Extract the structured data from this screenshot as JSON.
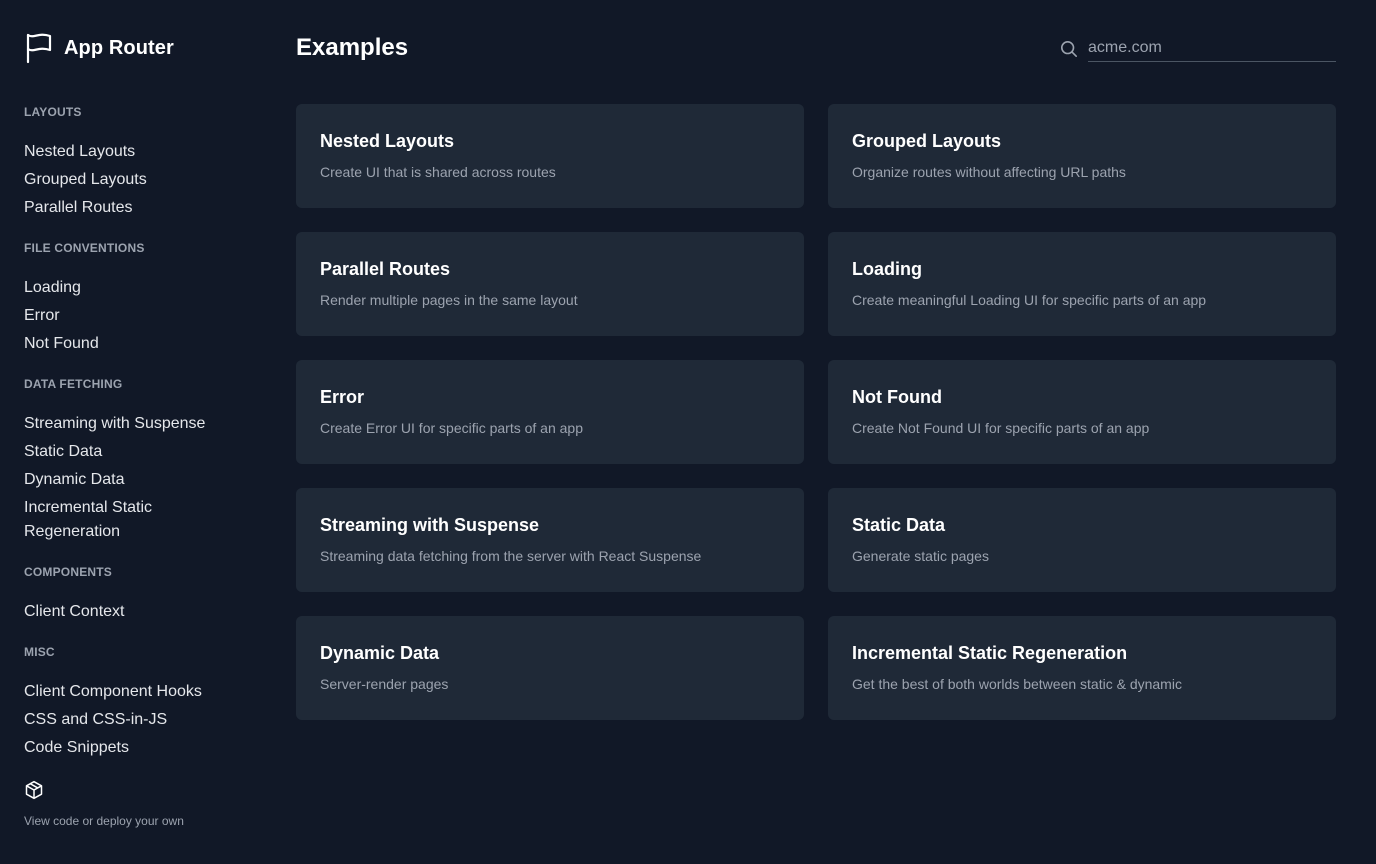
{
  "brand": {
    "title": "App Router"
  },
  "sidebar": {
    "groups": [
      {
        "label": "LAYOUTS",
        "items": [
          "Nested Layouts",
          "Grouped Layouts",
          "Parallel Routes"
        ]
      },
      {
        "label": "FILE CONVENTIONS",
        "items": [
          "Loading",
          "Error",
          "Not Found"
        ]
      },
      {
        "label": "DATA FETCHING",
        "items": [
          "Streaming with Suspense",
          "Static Data",
          "Dynamic Data",
          "Incremental Static Regeneration"
        ]
      },
      {
        "label": "COMPONENTS",
        "items": [
          "Client Context"
        ]
      },
      {
        "label": "MISC",
        "items": [
          "Client Component Hooks",
          "CSS and CSS-in-JS",
          "Code Snippets"
        ]
      }
    ],
    "footer_text": "View code or deploy your own",
    "footer_icon": "codesandbox-icon"
  },
  "main": {
    "title": "Examples",
    "search": {
      "placeholder": "acme.com",
      "value": "",
      "icon": "search-icon"
    },
    "cards": [
      {
        "title": "Nested Layouts",
        "description": "Create UI that is shared across routes"
      },
      {
        "title": "Grouped Layouts",
        "description": "Organize routes without affecting URL paths"
      },
      {
        "title": "Parallel Routes",
        "description": "Render multiple pages in the same layout"
      },
      {
        "title": "Loading",
        "description": "Create meaningful Loading UI for specific parts of an app"
      },
      {
        "title": "Error",
        "description": "Create Error UI for specific parts of an app"
      },
      {
        "title": "Not Found",
        "description": "Create Not Found UI for specific parts of an app"
      },
      {
        "title": "Streaming with Suspense",
        "description": "Streaming data fetching from the server with React Suspense"
      },
      {
        "title": "Static Data",
        "description": "Generate static pages"
      },
      {
        "title": "Dynamic Data",
        "description": "Server-render pages"
      },
      {
        "title": "Incremental Static Regeneration",
        "description": "Get the best of both worlds between static & dynamic"
      }
    ]
  },
  "colors": {
    "background": "#111827",
    "card": "#1f2937",
    "text_primary": "#ffffff",
    "text_secondary": "#9ca3af"
  }
}
